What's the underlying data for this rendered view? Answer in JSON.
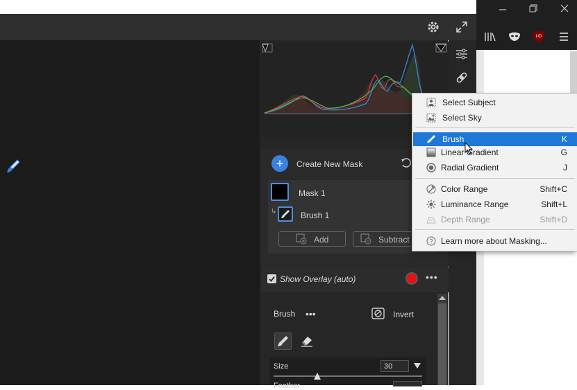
{
  "toolbar": {
    "settings_icon": "gear-icon",
    "fullscreen_icon": "expand-icon"
  },
  "browser": {
    "minimize_icon": "minimize-icon",
    "restore_icon": "restore-icon",
    "close_icon": "close-icon",
    "library_icon": "library-icon",
    "extension_icon": "mask-extension-icon",
    "ublock_label": "UD",
    "menu_icon": "hamburger-icon"
  },
  "masks": {
    "create_label": "Create New Mask",
    "items": [
      {
        "label": "Mask 1"
      },
      {
        "label": "Brush 1"
      }
    ],
    "add_label": "Add",
    "subtract_label": "Subtract"
  },
  "menu": {
    "items": [
      {
        "label": "Select Subject",
        "shortcut": "",
        "icon": "subject-icon"
      },
      {
        "label": "Select Sky",
        "shortcut": "",
        "icon": "sky-icon"
      },
      {
        "label": "Brush",
        "shortcut": "K",
        "icon": "brush-icon",
        "selected": true
      },
      {
        "label": "Linear Gradient",
        "shortcut": "G",
        "icon": "linear-gradient-icon"
      },
      {
        "label": "Radial Gradient",
        "shortcut": "J",
        "icon": "radial-gradient-icon"
      },
      {
        "label": "Color Range",
        "shortcut": "Shift+C",
        "icon": "color-range-icon"
      },
      {
        "label": "Luminance Range",
        "shortcut": "Shift+L",
        "icon": "luminance-range-icon"
      },
      {
        "label": "Depth Range",
        "shortcut": "Shift+D",
        "icon": "depth-range-icon",
        "disabled": true
      },
      {
        "label": "Learn more about Masking...",
        "shortcut": "",
        "icon": "help-icon"
      }
    ]
  },
  "overlay": {
    "label": "Show Overlay (auto)",
    "checked": true,
    "color": "#e81010"
  },
  "brush": {
    "title": "Brush",
    "invert_label": "Invert",
    "size_label": "Size",
    "size_value": "30",
    "feather_label": "Feather"
  },
  "colors": {
    "accent": "#1e78d7",
    "mask_border": "#4a90e2"
  }
}
